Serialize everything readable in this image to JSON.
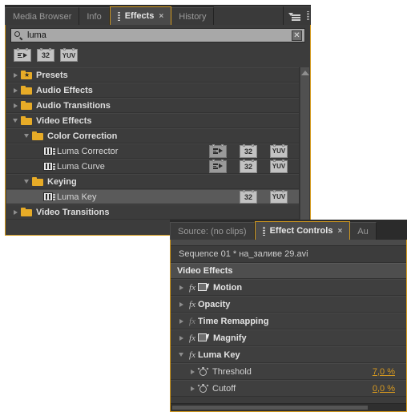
{
  "app": "Adobe Premiere Pro",
  "effects_panel": {
    "tabs": [
      {
        "label": "Media Browser",
        "active": false,
        "closable": false
      },
      {
        "label": "Info",
        "active": false,
        "closable": false
      },
      {
        "label": "Effects",
        "active": true,
        "closable": true,
        "close_glyph": "×"
      },
      {
        "label": "History",
        "active": false,
        "closable": false
      }
    ],
    "panel_menu_icon": "panel-menu-icon",
    "search": {
      "value": "luma",
      "placeholder": "",
      "icon": "search-icon",
      "clear_glyph": "✕"
    },
    "filters": [
      {
        "name": "accelerated-effects-filter",
        "label": "",
        "kind": "accel"
      },
      {
        "name": "32bit-color-filter",
        "label": "32",
        "kind": "text"
      },
      {
        "name": "yuv-filter",
        "label": "YUV",
        "kind": "text"
      }
    ],
    "tree": [
      {
        "label": "Presets",
        "depth": 0,
        "type": "folder-star",
        "expanded": false,
        "selected": false,
        "badges": []
      },
      {
        "label": "Audio Effects",
        "depth": 0,
        "type": "folder",
        "expanded": false,
        "selected": false,
        "badges": []
      },
      {
        "label": "Audio Transitions",
        "depth": 0,
        "type": "folder",
        "expanded": false,
        "selected": false,
        "badges": []
      },
      {
        "label": "Video Effects",
        "depth": 0,
        "type": "folder",
        "expanded": true,
        "selected": false,
        "badges": []
      },
      {
        "label": "Color Correction",
        "depth": 1,
        "type": "folder",
        "expanded": true,
        "selected": false,
        "badges": []
      },
      {
        "label": "Luma Corrector",
        "depth": 2,
        "type": "effect",
        "expanded": null,
        "selected": false,
        "badges": [
          "accel",
          "32",
          "YUV"
        ]
      },
      {
        "label": "Luma Curve",
        "depth": 2,
        "type": "effect",
        "expanded": null,
        "selected": false,
        "badges": [
          "accel",
          "32",
          "YUV"
        ]
      },
      {
        "label": "Keying",
        "depth": 1,
        "type": "folder",
        "expanded": true,
        "selected": false,
        "badges": []
      },
      {
        "label": "Luma Key",
        "depth": 2,
        "type": "effect",
        "expanded": null,
        "selected": true,
        "badges": [
          "",
          "32",
          "YUV"
        ]
      },
      {
        "label": "Video Transitions",
        "depth": 0,
        "type": "folder",
        "expanded": false,
        "selected": false,
        "badges": []
      }
    ],
    "scrollbar": {
      "name": "vertical-scrollbar",
      "up_arrow": "scroll-up-arrow"
    }
  },
  "effect_controls_panel": {
    "tabs": [
      {
        "label": "Source: (no clips)",
        "active": false,
        "closable": false
      },
      {
        "label": "Effect Controls",
        "active": true,
        "closable": true,
        "close_glyph": "×"
      },
      {
        "label": "Au",
        "active": false,
        "closable": false
      }
    ],
    "sequence_line": "Sequence 01 * на_заливе 29.avi",
    "section_header": "Video Effects",
    "rows": [
      {
        "label": "Motion",
        "depth": 0,
        "expanded": false,
        "fx": true,
        "fx_dim": false,
        "transform_icon": true,
        "stopwatch": false,
        "value": ""
      },
      {
        "label": "Opacity",
        "depth": 0,
        "expanded": false,
        "fx": true,
        "fx_dim": false,
        "transform_icon": false,
        "stopwatch": false,
        "value": ""
      },
      {
        "label": "Time Remapping",
        "depth": 0,
        "expanded": false,
        "fx": true,
        "fx_dim": true,
        "transform_icon": false,
        "stopwatch": false,
        "value": ""
      },
      {
        "label": "Magnify",
        "depth": 0,
        "expanded": false,
        "fx": true,
        "fx_dim": false,
        "transform_icon": true,
        "stopwatch": false,
        "value": ""
      },
      {
        "label": "Luma Key",
        "depth": 0,
        "expanded": true,
        "fx": true,
        "fx_dim": false,
        "transform_icon": false,
        "stopwatch": false,
        "value": ""
      },
      {
        "label": "Threshold",
        "depth": 1,
        "expanded": false,
        "fx": false,
        "fx_dim": false,
        "transform_icon": false,
        "stopwatch": true,
        "value": "7,0 %"
      },
      {
        "label": "Cutoff",
        "depth": 1,
        "expanded": false,
        "fx": false,
        "fx_dim": false,
        "transform_icon": false,
        "stopwatch": true,
        "value": "0,0 %"
      }
    ],
    "horizontal_scrollbar": "horizontal-scrollbar"
  },
  "colors": {
    "panel_border_accent": "#d39a1e",
    "panel_bg": "#3c3c3c",
    "tab_active_bg": "#4a4a4a",
    "value_orange": "#d89a20",
    "folder_yellow": "#e7ab27",
    "selection_bg": "#5a5a5a",
    "page_bg": "#ffffff"
  }
}
